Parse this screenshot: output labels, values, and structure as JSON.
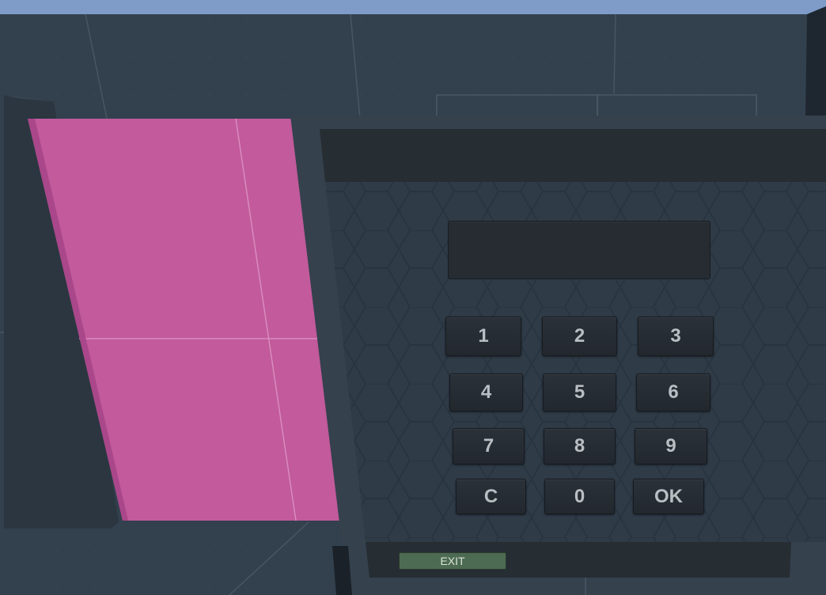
{
  "keypad": {
    "display_value": "",
    "keys": [
      "1",
      "2",
      "3",
      "4",
      "5",
      "6",
      "7",
      "8",
      "9",
      "C",
      "0",
      "OK"
    ]
  },
  "footer": {
    "exit_label": "EXIT"
  },
  "colors": {
    "sky": "#7f9bc8",
    "wall": "#33404d",
    "wall_dark": "#2c3742",
    "pink_surface": "#c25a9c",
    "panel": "#2f3b47",
    "key": "#262c32",
    "exit_button": "#4d6b52"
  }
}
